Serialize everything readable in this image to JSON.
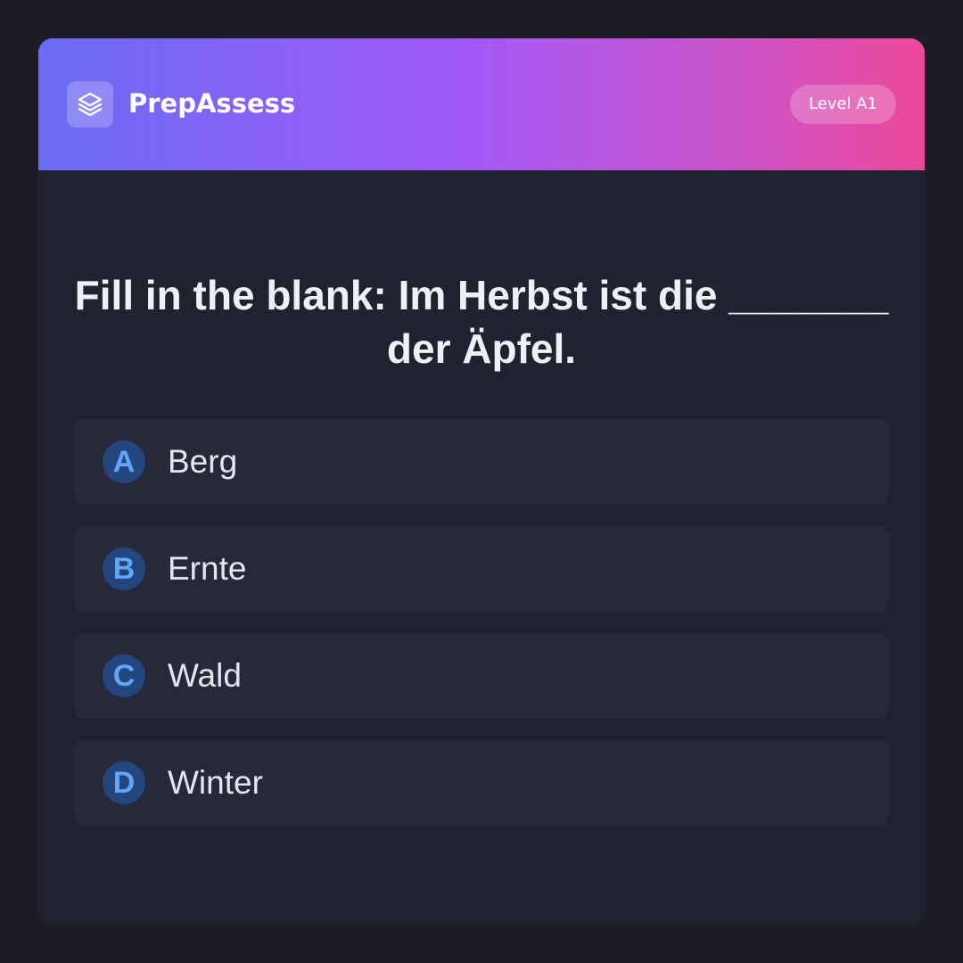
{
  "header": {
    "logo_icon": "layers-icon",
    "brand": "PrepAssess",
    "level": "Level A1"
  },
  "question": {
    "text": "Fill in the blank: Im Herbst ist die _______ der Äpfel."
  },
  "options": [
    {
      "letter": "A",
      "text": "Berg"
    },
    {
      "letter": "B",
      "text": "Ernte"
    },
    {
      "letter": "C",
      "text": "Wald"
    },
    {
      "letter": "D",
      "text": "Winter"
    }
  ],
  "colors": {
    "gradient_start": "#6a6cf4",
    "gradient_mid": "#a259f7",
    "gradient_end": "#ec4899",
    "card_background": "#202230",
    "option_background": "#272938",
    "letter_badge": "#24467e",
    "letter_text": "#5fa5f8"
  }
}
